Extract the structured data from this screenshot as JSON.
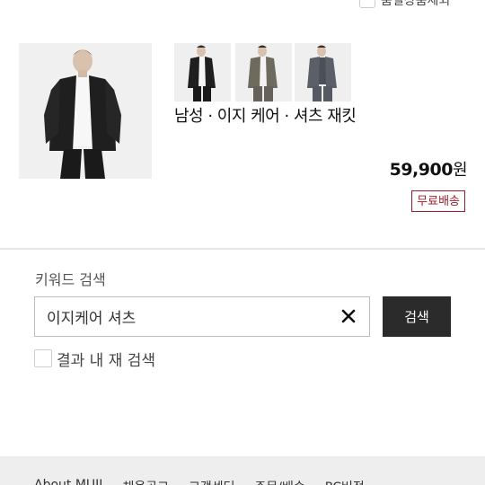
{
  "top_filter": {
    "label": "품절상품제외"
  },
  "product": {
    "title": "남성 · 이지 케어 · 셔츠 재킷",
    "price": "59,900",
    "currency": "원",
    "badge": "무료배송",
    "colors": [
      "black",
      "khaki-gray",
      "charcoal-gray"
    ]
  },
  "search": {
    "label": "키워드 검색",
    "value": "이지케어 셔츠",
    "button_label": "검색",
    "refine_label": "결과 내 재 검색"
  },
  "footer": {
    "links": [
      "About MUJI",
      "채용공고",
      "고객센터",
      "주문/배송",
      "PC버전"
    ]
  }
}
